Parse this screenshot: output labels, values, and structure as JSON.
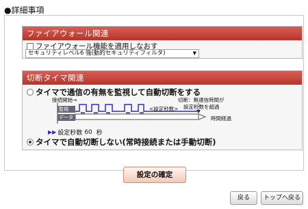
{
  "page_title": "●詳細事項",
  "firewall": {
    "header": "ファイアウォール関連",
    "reapply_label": "ファイアウォール機能を適用しなおす",
    "reapply_checked": false,
    "level_select": "セキュリティレベル6 強(動的セキュリティフィルタ)"
  },
  "disconnect": {
    "header": "切断タイマ関連",
    "option_monitor": "タイマで通信の有無を監視して自動切断をする",
    "option_monitor_selected": false,
    "diagram": {
      "start_label": "接続開始→",
      "disconnect_note_1": "切断：無通信時間が",
      "disconnect_note_2": "設定秒数を超過",
      "monitor_label": "監視",
      "data_label": "データ",
      "set_seconds_label": "<設定秒数>",
      "elapsed_label": "時間経過"
    },
    "timer_label": "設定秒数",
    "timer_value": "60",
    "timer_unit": "秒",
    "option_none": "タイマで自動切断しない(常時接続または手動切断)",
    "option_none_selected": true
  },
  "buttons": {
    "confirm": "設定の確定",
    "back": "戻る",
    "top": "トップへ戻る"
  },
  "colors": {
    "header_red": "#c0392b",
    "accent_blue": "#2b2bd1"
  }
}
